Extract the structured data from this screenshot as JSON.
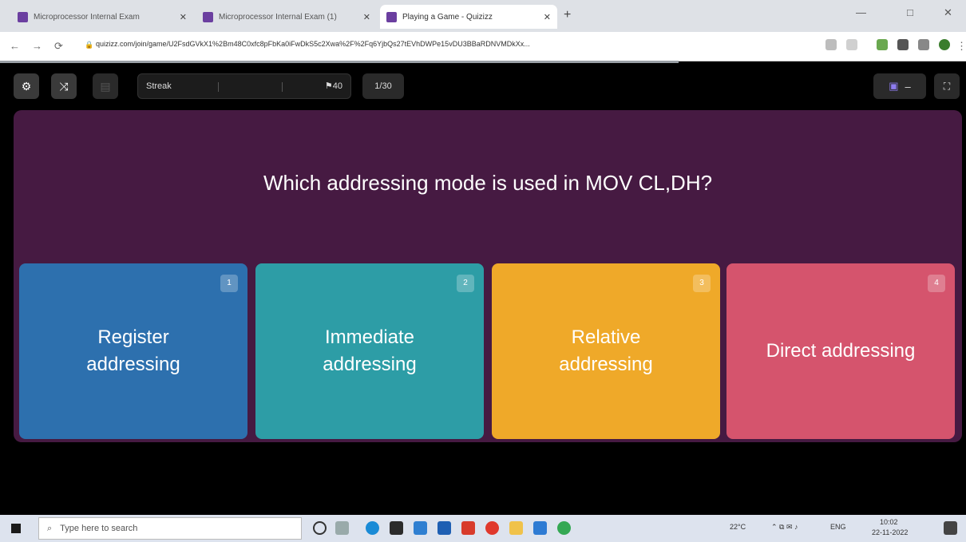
{
  "browser": {
    "tabs": [
      {
        "title": "Microprocessor Internal Exam"
      },
      {
        "title": "Microprocessor Internal Exam (1)"
      },
      {
        "title": "Playing a Game - Quizizz"
      }
    ],
    "new_tab": "+",
    "minimize": "—",
    "maximize": "□",
    "close": "✕",
    "url": "quizizz.com/join/game/U2FsdGVkX1%2Bm48C0xfc8pFbKa0iFwDkS5c2Xwa%2F%2Fq6YjbQs27tEVhDWPe15vDU3BBaRDNVMDkXx..."
  },
  "toolbar": {
    "settings_icon": "gear-icon",
    "shuffle_icon": "shuffle-icon",
    "streak_label": "Streak",
    "streak_score": "40",
    "question_counter": "1/30",
    "fullscreen_icon": "fullscreen-icon"
  },
  "question": {
    "text": "Which addressing mode is used in MOV CL,DH?"
  },
  "options": [
    {
      "num": "1",
      "label": "Register addressing",
      "color": "#2d70ae"
    },
    {
      "num": "2",
      "label": "Immediate addressing",
      "color": "#2d9da6"
    },
    {
      "num": "3",
      "label": "Relative addressing",
      "color": "#efa929"
    },
    {
      "num": "4",
      "label": "Direct addressing",
      "color": "#d5546d"
    }
  ],
  "taskbar": {
    "search_placeholder": "Type here to search",
    "weather": "22°C",
    "language": "ENG",
    "time": "10:02",
    "date": "22-11-2022"
  },
  "colors": {
    "panel": "#461a42",
    "background": "#000000"
  }
}
